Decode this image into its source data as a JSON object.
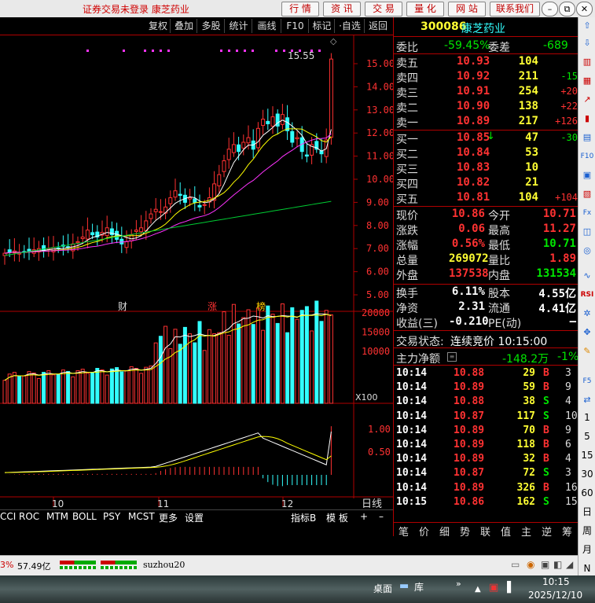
{
  "titlebar": {
    "title": "证券交易未登录  康芝药业",
    "menu": [
      "行 情",
      "资 讯",
      "交 易",
      "量 化",
      "网 站",
      "联系我们"
    ],
    "win": [
      "–",
      "⧉",
      "✕"
    ]
  },
  "toolbar": [
    "复权",
    "叠加",
    "多股",
    "统计",
    "画线",
    "F10",
    "标记",
    "·自选",
    "返回"
  ],
  "chart": {
    "high_label": "15.55",
    "price_axis": [
      "15.00",
      "14.00",
      "13.00",
      "12.00",
      "11.00",
      "10.00",
      "9.00",
      "8.00",
      "7.00",
      "6.00",
      "5.00"
    ],
    "markers": [
      "财",
      "涨",
      "榜"
    ],
    "volume_axis": [
      "20000",
      "15000",
      "10000"
    ],
    "volume_unit": "X100",
    "macd_axis": [
      "1.00",
      "0.50"
    ],
    "months": [
      "10",
      "11",
      "12"
    ],
    "period": "日线"
  },
  "indicator_tabs": [
    "CCI",
    "ROC",
    "MTM",
    "BOLL",
    "PSY",
    "MCST",
    "更多",
    "设置"
  ],
  "indicator_right": [
    "指标B",
    "模 板",
    "+",
    "–"
  ],
  "quote": {
    "code": "300086",
    "name": "康芝药业",
    "weibi_label": "委比",
    "weibi": "-59.45%",
    "weicha_label": "委差",
    "weicha": "-689",
    "asks": [
      {
        "label": "卖五",
        "price": "10.93",
        "vol": "104",
        "chg": ""
      },
      {
        "label": "卖四",
        "price": "10.92",
        "vol": "211",
        "chg": "-15"
      },
      {
        "label": "卖三",
        "price": "10.91",
        "vol": "254",
        "chg": "+20"
      },
      {
        "label": "卖二",
        "price": "10.90",
        "vol": "138",
        "chg": "+22"
      },
      {
        "label": "卖一",
        "price": "10.89",
        "vol": "217",
        "chg": "+126"
      }
    ],
    "bids": [
      {
        "label": "买一",
        "price": "10.85",
        "vol": "47",
        "chg": "-30"
      },
      {
        "label": "买二",
        "price": "10.84",
        "vol": "53",
        "chg": ""
      },
      {
        "label": "买三",
        "price": "10.83",
        "vol": "10",
        "chg": ""
      },
      {
        "label": "买四",
        "price": "10.82",
        "vol": "21",
        "chg": ""
      },
      {
        "label": "买五",
        "price": "10.81",
        "vol": "104",
        "chg": "+104"
      }
    ],
    "stats": [
      {
        "l1": "现价",
        "v1": "10.86",
        "l2": "今开",
        "v2": "10.71"
      },
      {
        "l1": "涨跌",
        "v1": "0.06",
        "l2": "最高",
        "v2": "11.27"
      },
      {
        "l1": "涨幅",
        "v1": "0.56%",
        "l2": "最低",
        "v2": "10.71"
      },
      {
        "l1": "总量",
        "v1": "269072",
        "l2": "量比",
        "v2": "1.89"
      },
      {
        "l1": "外盘",
        "v1": "137538",
        "l2": "内盘",
        "v2": "131534"
      }
    ],
    "stats2": [
      {
        "l1": "换手",
        "v1": "6.11%",
        "l2": "股本",
        "v2": "4.55亿"
      },
      {
        "l1": "净资",
        "v1": "2.31",
        "l2": "流通",
        "v2": "4.41亿"
      },
      {
        "l1": "收益(三)",
        "v1": "-0.210",
        "l2": "PE(动)",
        "v2": "–"
      }
    ],
    "status_label": "交易状态:",
    "status_value": "连续竞价 10:15:00",
    "net_label": "主力净额",
    "net_value": "-148.2万",
    "net_pct": "-1%",
    "ticks": [
      {
        "t": "10:14",
        "p": "10.88",
        "v": "29",
        "s": "B",
        "n": "3"
      },
      {
        "t": "10:14",
        "p": "10.89",
        "v": "59",
        "s": "B",
        "n": "9"
      },
      {
        "t": "10:14",
        "p": "10.88",
        "v": "38",
        "s": "S",
        "n": "4"
      },
      {
        "t": "10:14",
        "p": "10.87",
        "v": "117",
        "s": "S",
        "n": "10"
      },
      {
        "t": "10:14",
        "p": "10.89",
        "v": "70",
        "s": "B",
        "n": "9"
      },
      {
        "t": "10:14",
        "p": "10.89",
        "v": "118",
        "s": "B",
        "n": "6"
      },
      {
        "t": "10:14",
        "p": "10.89",
        "v": "32",
        "s": "B",
        "n": "4"
      },
      {
        "t": "10:14",
        "p": "10.87",
        "v": "72",
        "s": "S",
        "n": "3"
      },
      {
        "t": "10:14",
        "p": "10.89",
        "v": "326",
        "s": "B",
        "n": "16"
      },
      {
        "t": "10:15",
        "p": "10.86",
        "v": "162",
        "s": "S",
        "n": "15"
      }
    ],
    "bottom_tabs": [
      "笔",
      "价",
      "细",
      "势",
      "联",
      "值",
      "主",
      "逆",
      "筹"
    ]
  },
  "sidebar": {
    "periods": [
      "1",
      "5",
      "15",
      "30",
      "60",
      "日",
      "周",
      "月",
      "N"
    ]
  },
  "statusbar": {
    "left_pct": "3%",
    "amount": "57.49亿",
    "user": "suzhou20"
  },
  "taskbar": {
    "desktop": "桌面",
    "lib": "库",
    "time": "10:15",
    "date": "2025/12/10"
  }
}
